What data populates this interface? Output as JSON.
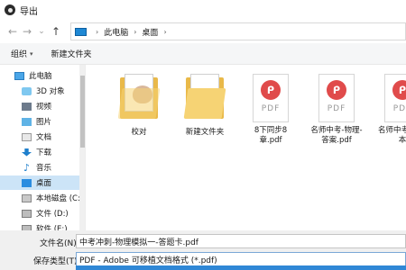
{
  "window": {
    "title": "导出"
  },
  "address": {
    "crumbs": [
      "此电脑",
      "桌面"
    ],
    "nav": {
      "back": "←",
      "forward": "→",
      "recent": "⌄",
      "up": "↑"
    }
  },
  "toolbar": {
    "organize": "组织",
    "new_folder": "新建文件夹"
  },
  "sidebar": {
    "items": [
      {
        "label": "此电脑",
        "icon": "pc-icon"
      },
      {
        "label": "3D 对象",
        "icon": "3d-objects-icon"
      },
      {
        "label": "视频",
        "icon": "video-icon"
      },
      {
        "label": "图片",
        "icon": "pictures-icon"
      },
      {
        "label": "文档",
        "icon": "documents-icon"
      },
      {
        "label": "下载",
        "icon": "download-icon"
      },
      {
        "label": "音乐",
        "icon": "music-icon"
      },
      {
        "label": "桌面",
        "icon": "desktop-icon",
        "selected": true
      },
      {
        "label": "本地磁盘 (C:)",
        "icon": "disk-icon"
      },
      {
        "label": "文件 (D:)",
        "icon": "disk-icon"
      },
      {
        "label": "软件 (E:)",
        "icon": "disk-icon"
      }
    ]
  },
  "files": [
    {
      "name": "校对",
      "type": "folder"
    },
    {
      "name": "新建文件夹",
      "type": "folder"
    },
    {
      "name": "8下同步8章.pdf",
      "type": "pdf"
    },
    {
      "name": "名师中考-物理-答案.pdf",
      "type": "pdf"
    },
    {
      "name": "名师中考-课堂本",
      "type": "pdf"
    }
  ],
  "pdf_badge": "PDF",
  "form": {
    "filename_label": "文件名(N):",
    "filename_value": "中考冲刺-物理模拟一-答题卡.pdf",
    "filetype_label": "保存类型(T):",
    "filetype_value": "PDF - Adobe 可移植文档格式 (*.pdf)"
  }
}
